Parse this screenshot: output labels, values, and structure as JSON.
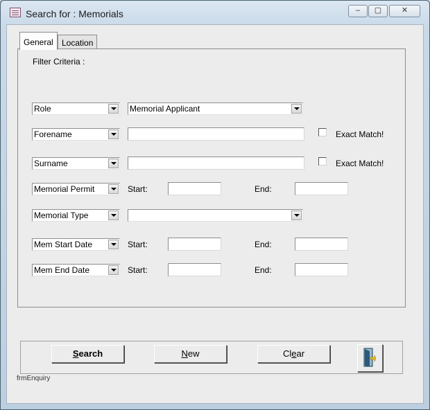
{
  "window": {
    "title": "Search for : Memorials",
    "close_glyph": "✕",
    "minimize_glyph": "–",
    "maximize_glyph": "▢"
  },
  "tabs": [
    {
      "label": "General"
    },
    {
      "label": "Location"
    }
  ],
  "filter_criteria_label": "Filter Criteria :",
  "rows": {
    "role": {
      "field": "Role",
      "value": "Memorial Applicant"
    },
    "forename": {
      "field": "Forename",
      "value": "",
      "exact_match_label": "Exact Match!"
    },
    "surname": {
      "field": "Surname",
      "value": "",
      "exact_match_label": "Exact Match!"
    },
    "memorial_permit": {
      "field": "Memorial Permit",
      "start_label": "Start:",
      "end_label": "End:"
    },
    "memorial_type": {
      "field": "Memorial Type",
      "value": ""
    },
    "mem_start_date": {
      "field": "Mem Start Date",
      "start_label": "Start:",
      "end_label": "End:"
    },
    "mem_end_date": {
      "field": "Mem End Date",
      "start_label": "Start:",
      "end_label": "End:"
    }
  },
  "buttons": {
    "search": {
      "label_prefix": "",
      "label_key": "S",
      "label_rest": "earch"
    },
    "new": {
      "label_key": "N",
      "label_rest": "ew"
    },
    "clear": {
      "label_prefix": "Cl",
      "label_key": "e",
      "label_rest": "ar"
    },
    "exit_icon": "exit-door-icon"
  },
  "form_name": "frmEnquiry",
  "colors": {
    "titlebar": "#dbe7f2",
    "panel": "#ececec",
    "door": "#2a5a7a",
    "arrow": "#f0c020"
  }
}
